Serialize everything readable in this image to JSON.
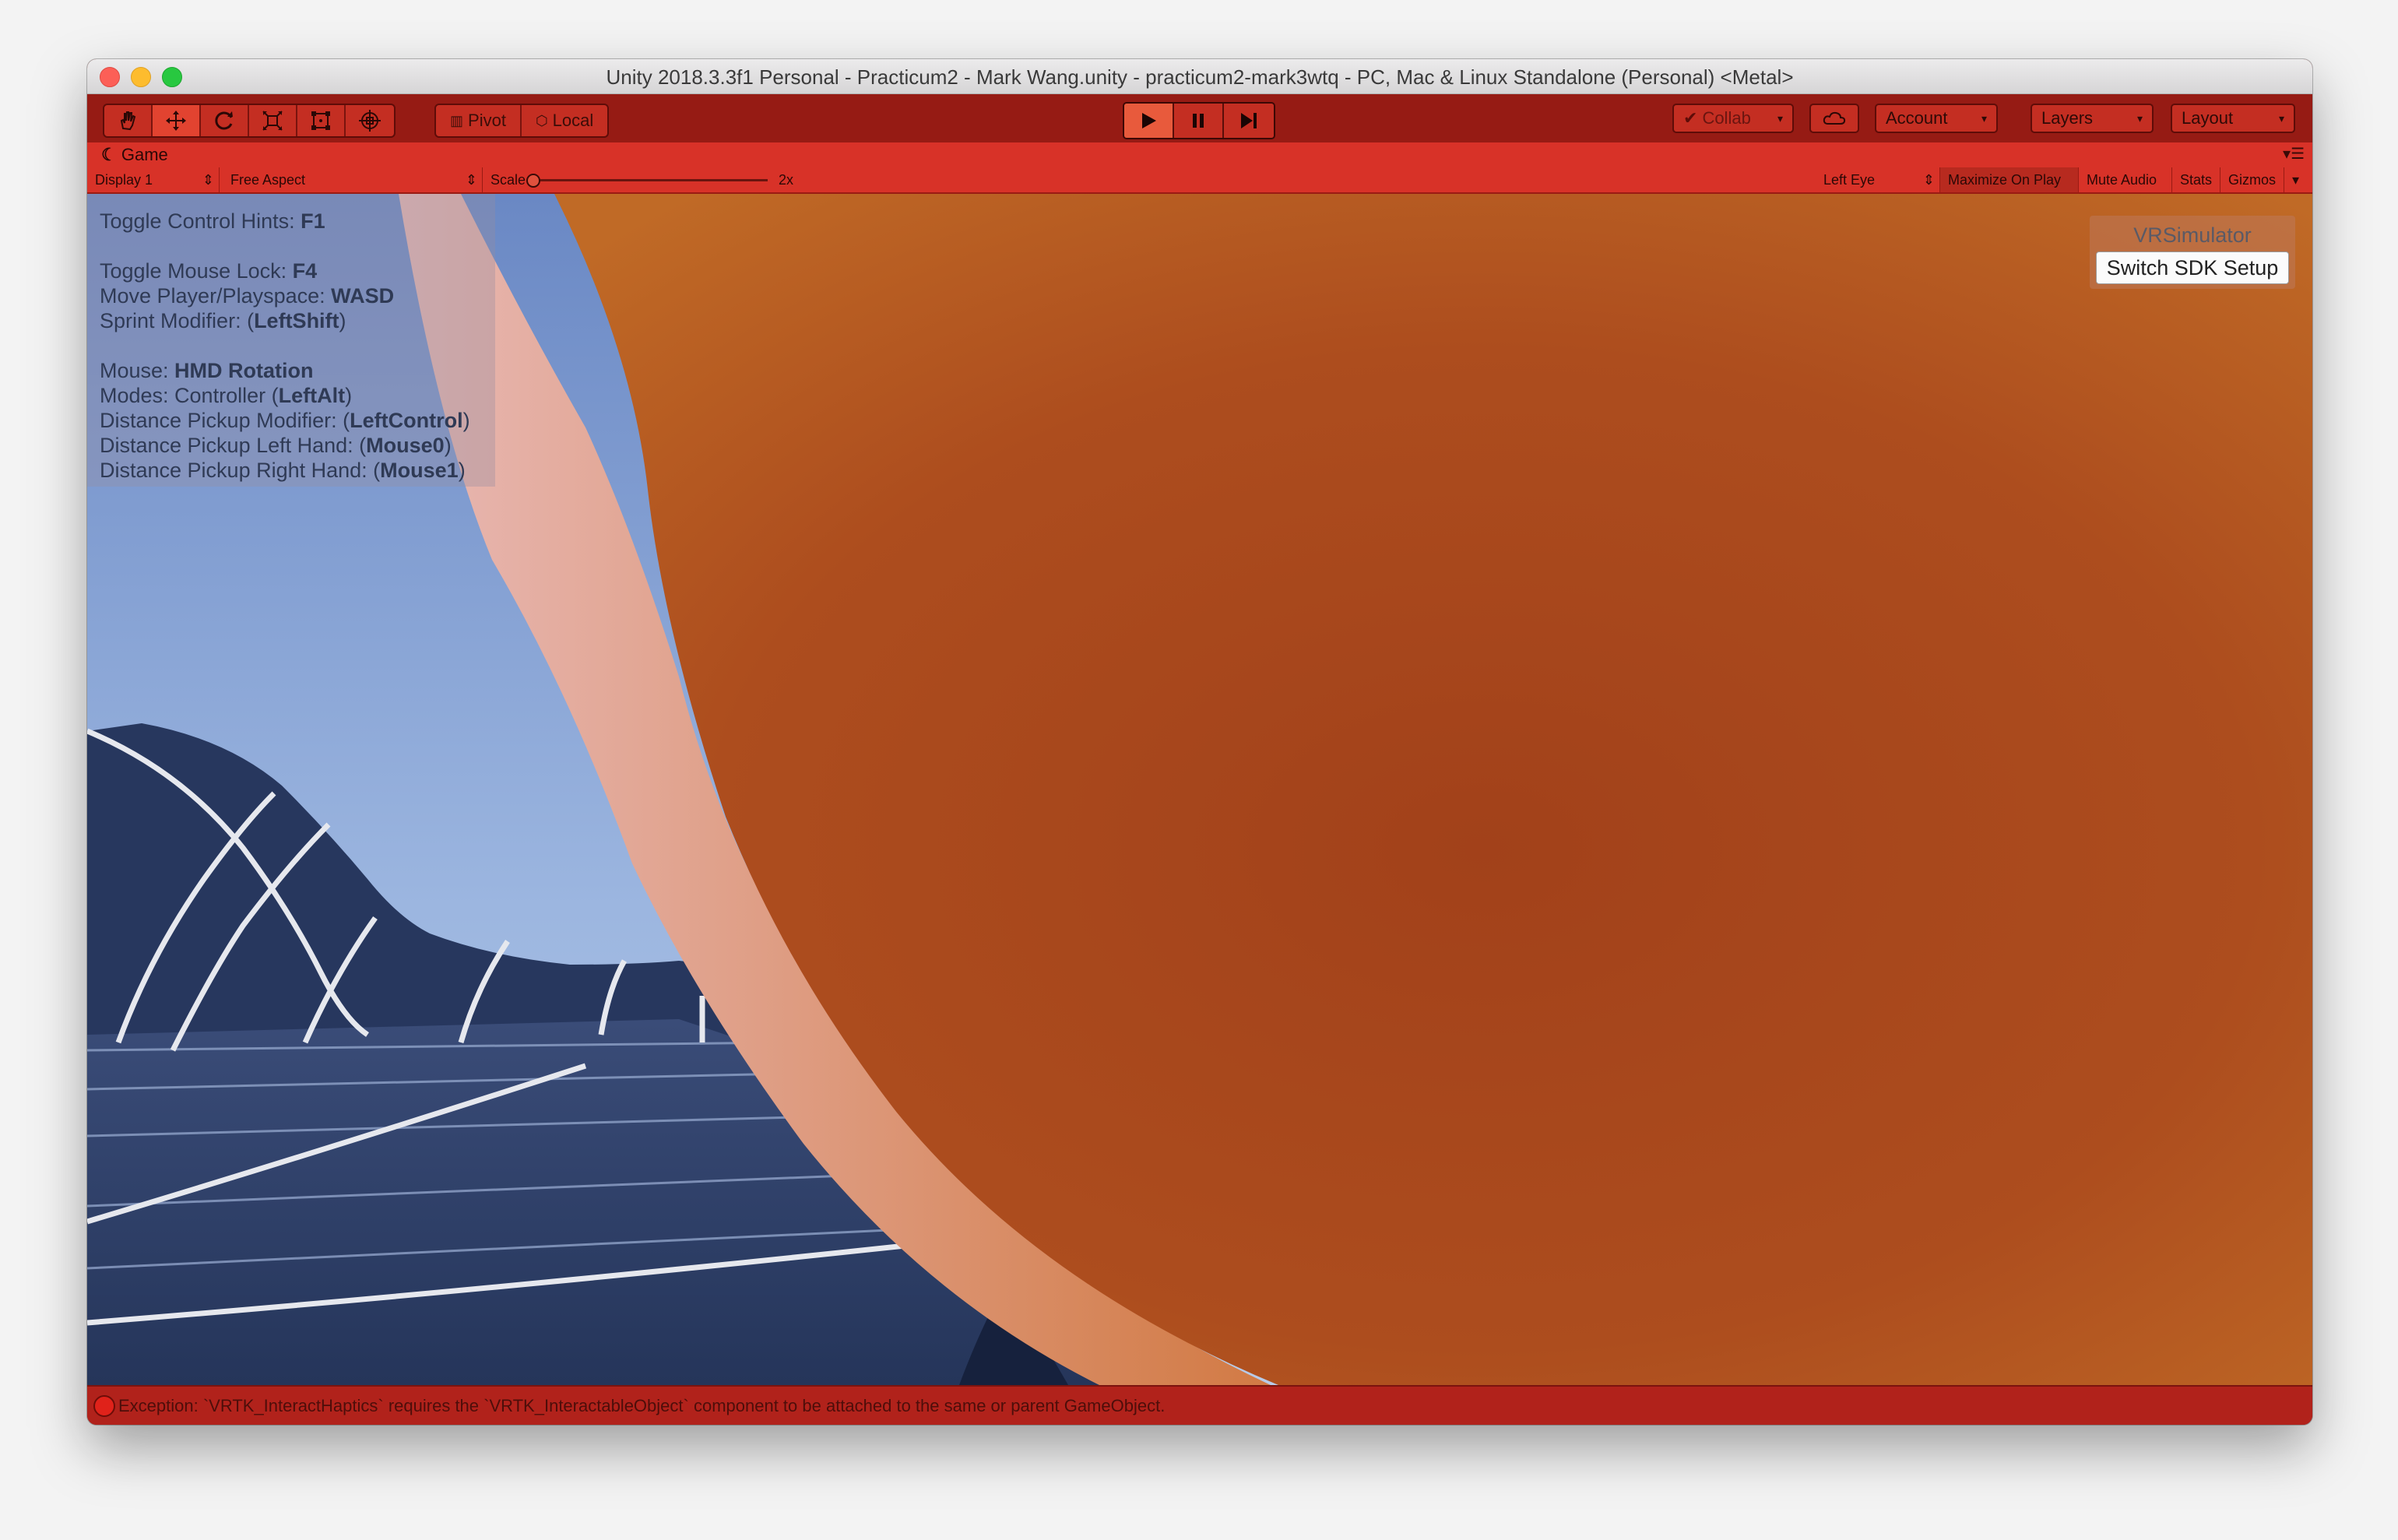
{
  "window": {
    "title": "Unity 2018.3.3f1 Personal - Practicum2 - Mark Wang.unity - practicum2-mark3wtq - PC, Mac & Linux Standalone (Personal) <Metal>"
  },
  "toolbar": {
    "transform_tools": [
      "hand-tool",
      "move-tool",
      "rotate-tool",
      "scale-tool",
      "rect-tool",
      "transform-tool"
    ],
    "pivot_label": "Pivot",
    "local_label": "Local",
    "collab_label": "Collab",
    "account_label": "Account",
    "layers_label": "Layers",
    "layout_label": "Layout"
  },
  "game_tab": {
    "label": "Game",
    "display_label": "Display 1",
    "aspect_label": "Free Aspect",
    "scale_label": "Scale",
    "scale_value": "2x",
    "eye_label": "Left Eye",
    "maximize_label": "Maximize On Play",
    "mute_label": "Mute Audio",
    "stats_label": "Stats",
    "gizmos_label": "Gizmos"
  },
  "hints": [
    {
      "text": "Toggle Control Hints: ",
      "key": "F1",
      "suffix": ""
    },
    {
      "text": "Toggle Mouse Lock: ",
      "key": "F4",
      "suffix": ""
    },
    {
      "text": "Move Player/Playspace: ",
      "key": "WASD",
      "suffix": ""
    },
    {
      "text": "Sprint Modifier: (",
      "key": "LeftShift",
      "suffix": ")"
    },
    {
      "text": "Mouse: ",
      "key": "HMD Rotation",
      "suffix": ""
    },
    {
      "text": "Modes: Controller (",
      "key": "LeftAlt",
      "suffix": ")"
    },
    {
      "text": "Distance Pickup Modifier: (",
      "key": "LeftControl",
      "suffix": ")"
    },
    {
      "text": "Distance Pickup Left Hand: (",
      "key": "Mouse0",
      "suffix": ")"
    },
    {
      "text": "Distance Pickup Right Hand: (",
      "key": "Mouse1",
      "suffix": ")"
    }
  ],
  "vr_panel": {
    "title": "VRSimulator",
    "button_label": "Switch SDK Setup"
  },
  "status": {
    "message": "Exception: `VRTK_InteractHaptics` requires the `VRTK_InteractableObject` component to be attached to the same or parent GameObject."
  },
  "colors": {
    "toolbar": "#961b14",
    "tab_bar": "#d83228",
    "orange_object": "#b8531d",
    "floor": "#2e3f66"
  }
}
